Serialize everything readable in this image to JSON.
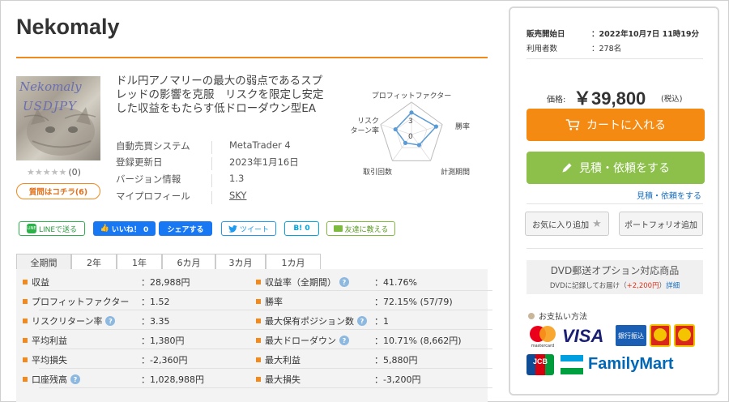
{
  "product": {
    "title": "Nekomaly",
    "image_text_1": "Nekomaly",
    "image_text_2": "USDJPY",
    "rating_count": "(0)",
    "qa_label": "質問はコチラ(6)",
    "description": "ドル円アノマリーの最大の弱点であるスプレッドの影響を克服　リスクを限定し安定した収益をもたらす低ドローダウン型EA"
  },
  "info": [
    {
      "label": "自動売買システム",
      "value": "MetaTrader 4"
    },
    {
      "label": "登録更新日",
      "value": "2023年1月16日"
    },
    {
      "label": "バージョン情報",
      "value": "1.3"
    },
    {
      "label": "マイプロフィール",
      "value": "SKY"
    }
  ],
  "radar": {
    "labels": [
      "プロフィットファクター",
      "勝率",
      "計測期間",
      "取引回数",
      "リスク",
      "ターン率"
    ],
    "tick_3": "3",
    "tick_0": "0",
    "values": [
      3.4,
      4.0,
      2.0,
      1.6,
      2.6
    ],
    "max": 5
  },
  "social": {
    "line": "LINEで送る",
    "line_icon": "LINE",
    "fb_like": "いいね！ 0",
    "fb_share": "シェアする",
    "tweet": "ツイート",
    "hatena": "B! 0",
    "mail": "友達に教える"
  },
  "tabs": [
    "全期間",
    "2年",
    "1年",
    "6カ月",
    "3カ月",
    "1カ月"
  ],
  "stats_left": [
    {
      "label": "収益",
      "value": "：28,988円",
      "help": false
    },
    {
      "label": "プロフィットファクター",
      "value": "：1.52",
      "help": false
    },
    {
      "label": "リスクリターン率",
      "value": "：3.35",
      "help": true
    },
    {
      "label": "平均利益",
      "value": "：1,380円",
      "help": false
    },
    {
      "label": "平均損失",
      "value": "：-2,360円",
      "help": false
    },
    {
      "label": "口座残高",
      "value": "：1,028,988円",
      "help": true
    }
  ],
  "stats_right": [
    {
      "label": "収益率（全期間）",
      "value": "：41.76%",
      "help": true
    },
    {
      "label": "勝率",
      "value": "：72.15% (57/79)",
      "help": false
    },
    {
      "label": "最大保有ポジション数",
      "value": "：1",
      "help": true
    },
    {
      "label": "最大ドローダウン",
      "value": "：10.71% (8,662円)",
      "help": true
    },
    {
      "label": "最大利益",
      "value": "：5,880円",
      "help": false
    },
    {
      "label": "最大損失",
      "value": "：-3,200円",
      "help": false
    }
  ],
  "help_mark": "?",
  "panel": {
    "sale_start_label": "販売開始日",
    "sale_start_value": "：2022年10月7日 11時19分",
    "users_label": "利用者数",
    "users_value": "：278名",
    "price_label": "価格:",
    "price": "￥39,800",
    "tax": "(税込)",
    "cart_button": "カートに入れる",
    "estimate_button": "見積・依頼をする",
    "estimate_link": "見積・依頼をする",
    "favorite_button": "お気に入り追加",
    "portfolio_button": "ポートフォリオ追加",
    "dvd_title": "DVD郵送オプション対応商品",
    "dvd_sub_1": "DVDに記録してお届け（",
    "dvd_sub_price": "+2,200円",
    "dvd_sub_2": "）",
    "dvd_detail": "詳細",
    "payment_title": "お支払い方法",
    "logos": {
      "mastercard": "mastercard",
      "visa": "VISA",
      "bank": "銀行振込",
      "jcb": "JCB",
      "familymart": "FamilyMart"
    }
  },
  "colors": {
    "accent": "#f08a1c",
    "cart": "#f58a12",
    "estimate": "#8cc04a",
    "link": "#1a6fc0"
  }
}
